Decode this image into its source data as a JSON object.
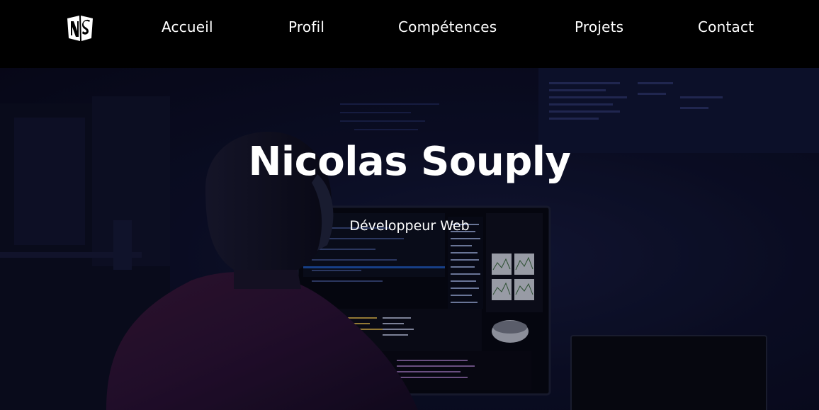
{
  "nav": {
    "logo_icon": "ns-monogram-logo",
    "items": [
      {
        "label": "Accueil"
      },
      {
        "label": "Profil"
      },
      {
        "label": "Compétences"
      },
      {
        "label": "Projets"
      },
      {
        "label": "Contact"
      }
    ]
  },
  "hero": {
    "title": "Nicolas Souply",
    "subtitle": "Développeur Web",
    "background": "developer-at-monitor-photo"
  }
}
